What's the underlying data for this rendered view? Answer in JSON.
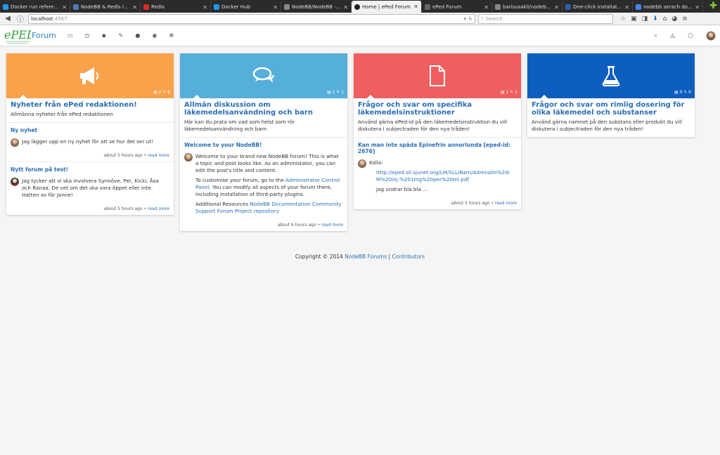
{
  "tabs": [
    {
      "label": "Docker run refere...",
      "color": "#2496ed",
      "active": false
    },
    {
      "label": "NodeBB & Redis In...",
      "color": "#4a7db0",
      "active": false
    },
    {
      "label": "Redis",
      "color": "#d82c20",
      "active": false
    },
    {
      "label": "Docker Hub",
      "color": "#2496ed",
      "active": false
    },
    {
      "label": "NodeBB/NodeBB -...",
      "color": "#888",
      "active": false
    },
    {
      "label": "Home | ePed Forum",
      "color": "#ffffff",
      "active": true
    },
    {
      "label": "ePed Forum",
      "color": "#666",
      "active": false
    },
    {
      "label": "barisusakli/nodebb...",
      "color": "#888",
      "active": false
    },
    {
      "label": "One-click installati...",
      "color": "#2a5fa8",
      "active": false
    },
    {
      "label": "nodebb serach do...",
      "color": "#4285f4",
      "active": false
    }
  ],
  "address": {
    "host": "localhost",
    "port": ":4567"
  },
  "search_placeholder": "Search",
  "brand": "Forum",
  "categories": [
    {
      "title": "Nyheter från ePed redaktionen!",
      "desc": "Allmänna nyheter från ePed redaktionen",
      "color": "#f9a24a",
      "icon": "megaphone-icon",
      "stats": "▤ 2 ✎ 6",
      "topics": [
        {
          "title": "Ny nyhet",
          "lines": [
            "Jag lägger upp en ny nyhet för att se hur det ser ut!"
          ],
          "meta": "about 5 hours ago",
          "read": "read more",
          "avatar": "a"
        },
        {
          "title": "Nytt forum på test!",
          "lines": [
            "Jag tycker att vi ska involvera Synnöve, Per, Kicki, Åsa och Ranaa. De vet om det ska vara öppet eller inte.",
            "Hatten av för Janne!"
          ],
          "meta": "about 5 hours ago",
          "read": "read more",
          "avatar": "b"
        }
      ]
    },
    {
      "title": "Allmän diskussion om läkemedelsanvändning och barn",
      "desc": "Här kan du prata om vad som helst som rör läkemedelsanvändning och barn",
      "color": "#56aeda",
      "icon": "chat-bubbles-icon",
      "stats": "▤ 1 ✎ 1",
      "topics": [
        {
          "title": "Welcome to your NodeBB!",
          "p1": "Welcome to your brand new NodeBB forum! This is what a topic and post looks like. As an administator, you can edit the post's title and content.",
          "p2a": "To customise your forum, go to the ",
          "p2link": "Administrator Control Panel",
          "p2b": ". You can modify all aspects of your forum there, including installation of third-party plugins.",
          "p3a": "Additional Resources ",
          "p3link": "NodeBB Documentation Community Support Forum Project repository",
          "meta": "about 6 hours ago",
          "read": "read more"
        }
      ]
    },
    {
      "title": "Frågor och svar om specifika läkemedelsinstruktioner",
      "desc": "Använd gärna ePed-id på den läkemedelsinstruktion du vill diskutera i subjectraden för den nya tråden!",
      "color": "#ef5f5f",
      "icon": "document-icon",
      "stats": "▤ 1 ✎ 1",
      "topics": [
        {
          "title": "Kan man inte späda Epinefrin annorlunda [eped-id: 2676]",
          "p1": "Kolla:",
          "link": "http://eped.sll.sjunet.org/LM/SLL/Barn/Adrenalin%20IM%20inj.%201mg%20per%20ml.pdf",
          "p2": "Jag undrar bla bla ...",
          "meta": "about 5 hours ago",
          "read": "read more"
        }
      ]
    },
    {
      "title": "Frågor och svar om rimlig dosering för olika läkemedel och substanser",
      "desc": "Använd gärna namnet på den substans eller produkt du vill diskutera i subjectraden för den nya tråden!",
      "color": "#0e5ec0",
      "icon": "flask-icon",
      "stats": "▤ 0 ✎ 0",
      "topics": []
    }
  ],
  "footer": {
    "text": "Copyright © 2014 ",
    "link1": "NodeBB Forums",
    "sep": " | ",
    "link2": "Contributors"
  }
}
